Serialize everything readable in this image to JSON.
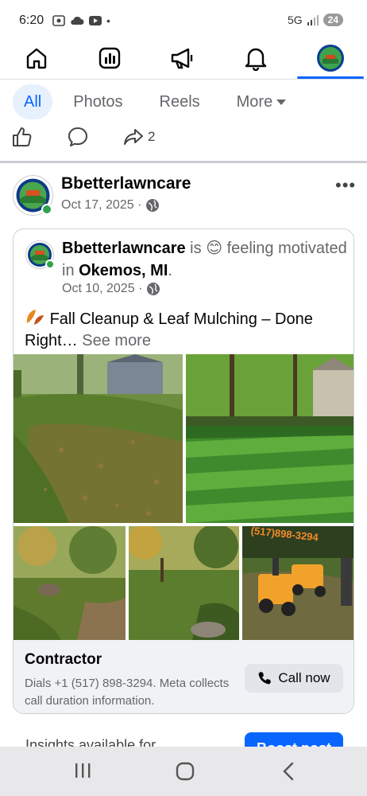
{
  "status": {
    "time": "6:20",
    "network": "5G",
    "battery": "24"
  },
  "nav": {
    "items": [
      {
        "name": "home-icon"
      },
      {
        "name": "dashboard-icon"
      },
      {
        "name": "megaphone-icon"
      },
      {
        "name": "bell-icon"
      },
      {
        "name": "profile-avatar"
      }
    ],
    "active": "profile-avatar"
  },
  "tabs": [
    {
      "label": "All",
      "active": true
    },
    {
      "label": "Photos",
      "active": false
    },
    {
      "label": "Reels",
      "active": false
    },
    {
      "label": "More",
      "active": false
    }
  ],
  "actions": {
    "share_count": "2"
  },
  "post": {
    "page_name": "Bbetterlawncare",
    "date": "Oct 17, 2025 ·",
    "shared": {
      "name": "Bbetterlawncare",
      "is": " is ",
      "emoji": "😊",
      "feeling": " feeling motivated in ",
      "location": "Okemos, MI",
      "period": ".",
      "date": "Oct 10, 2025 ·",
      "text": "Fall Cleanup & Leaf Mulching – Done Right…",
      "see_more": " See more",
      "cta": {
        "title": "Contractor",
        "desc": "Dials +1 (517) 898-3294. Meta collects call duration information.",
        "button": "Call now"
      }
    }
  },
  "bottom": {
    "insight_text": "Insights available for...",
    "boost_label": "Boost post"
  },
  "colors": {
    "accent": "#0866ff",
    "online": "#31a24c",
    "muted": "#65676b"
  }
}
